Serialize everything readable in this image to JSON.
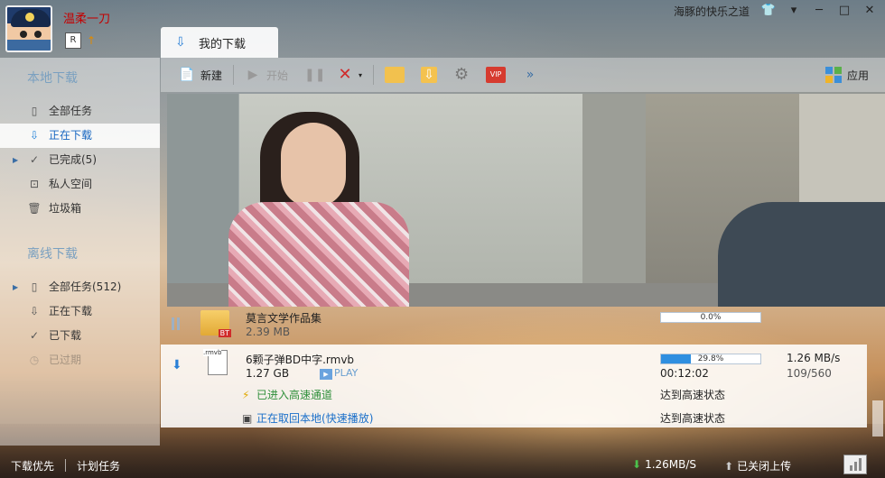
{
  "user": {
    "name": "温柔一刀"
  },
  "window": {
    "title": "海豚的快乐之道",
    "buttons": [
      "👕",
      "▾",
      "─",
      "□",
      "✕"
    ]
  },
  "main_tab": {
    "label": "我的下载"
  },
  "sidebar": {
    "local_header": "本地下载",
    "local_items": [
      {
        "label": "全部任务",
        "icon": "file-icon"
      },
      {
        "label": "正在下载",
        "icon": "download-arrow-icon"
      },
      {
        "label": "已完成(5)",
        "icon": "check-icon"
      },
      {
        "label": "私人空间",
        "icon": "lock-icon"
      },
      {
        "label": "垃圾箱",
        "icon": "trash-icon"
      }
    ],
    "offline_header": "离线下载",
    "offline_items": [
      {
        "label": "全部任务(512)",
        "icon": "file-icon"
      },
      {
        "label": "正在下载",
        "icon": "download-arrow-icon"
      },
      {
        "label": "已下载",
        "icon": "check-icon"
      },
      {
        "label": "已过期",
        "icon": "clock-icon"
      }
    ]
  },
  "toolbar": {
    "new_label": "新建",
    "start_label": "开始",
    "apps_label": "应用",
    "vip_label": "VIP"
  },
  "tasks": [
    {
      "name": "莫言文学作品集",
      "size": "2.39 MB",
      "progress_text": "0.0%",
      "progress": 0.0,
      "type_tag": "BT"
    },
    {
      "name": "6颗子弹BD中字.rmvb",
      "size": "1.27 GB",
      "file_tag": ".rmvb",
      "play_label": "PLAY",
      "progress_text": "29.8%",
      "progress": 0.298,
      "speed": "1.26 MB/s",
      "time_left": "00:12:02",
      "pieces": "109/560",
      "status1": "已进入高速通道",
      "status2_prefix": "正在取回本地(",
      "status2_link": "快速播放",
      "status2_suffix": ")",
      "state1": "达到高速状态",
      "state2": "达到高速状态"
    }
  ],
  "statusbar": {
    "priority": "下载优先",
    "schedule": "计划任务",
    "download_speed": "1.26MB/S",
    "upload": "已关闭上传"
  }
}
